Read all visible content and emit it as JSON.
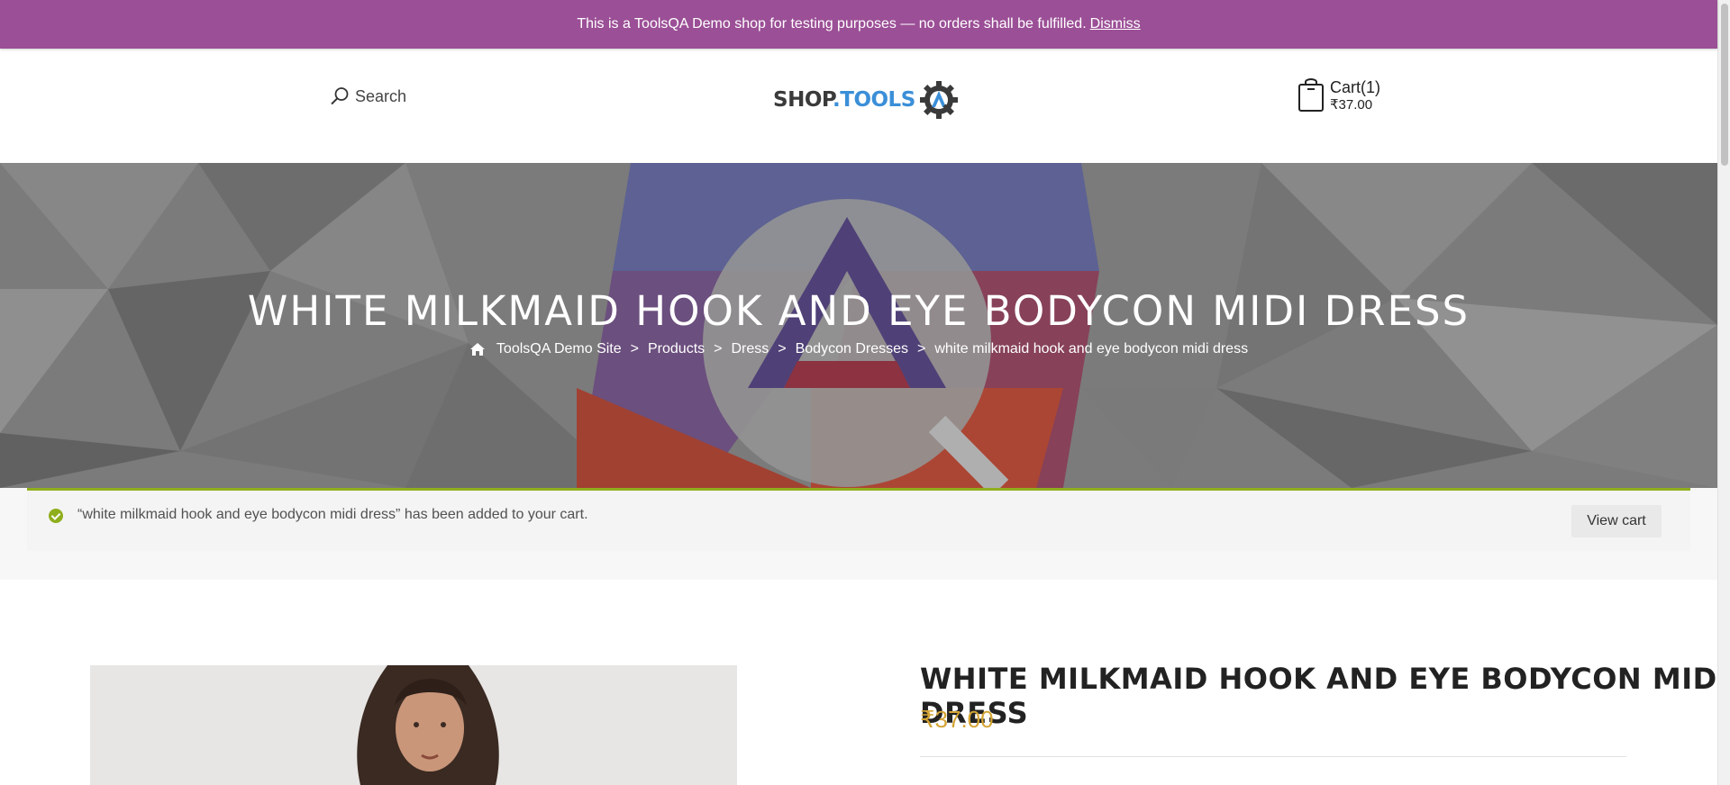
{
  "notice": {
    "text": "This is a ToolsQA Demo shop for testing purposes — no orders shall be fulfilled.",
    "dismiss_label": "Dismiss"
  },
  "header": {
    "search_label": "Search",
    "logo_alt": "SHOP.TOOLSQA",
    "cart_label": "Cart(1)",
    "cart_total": "₹37.00"
  },
  "hero": {
    "title": "WHITE MILKMAID HOOK AND EYE BODYCON MIDI DRESS",
    "breadcrumb": [
      "ToolsQA Demo Site",
      "Products",
      "Dress",
      "Bodycon Dresses",
      "white milkmaid hook and eye bodycon midi dress"
    ],
    "separator": ">"
  },
  "message": {
    "text": "“white milkmaid hook and eye bodycon midi dress” has been added to your cart.",
    "view_cart_label": "View cart"
  },
  "product": {
    "title": "WHITE MILKMAID HOOK AND EYE BODYCON MIDI DRESS",
    "price": "₹37.00"
  },
  "colors": {
    "notice_bg": "#9b4f96",
    "success_accent": "#8fae1b",
    "price": "#d4a434"
  }
}
